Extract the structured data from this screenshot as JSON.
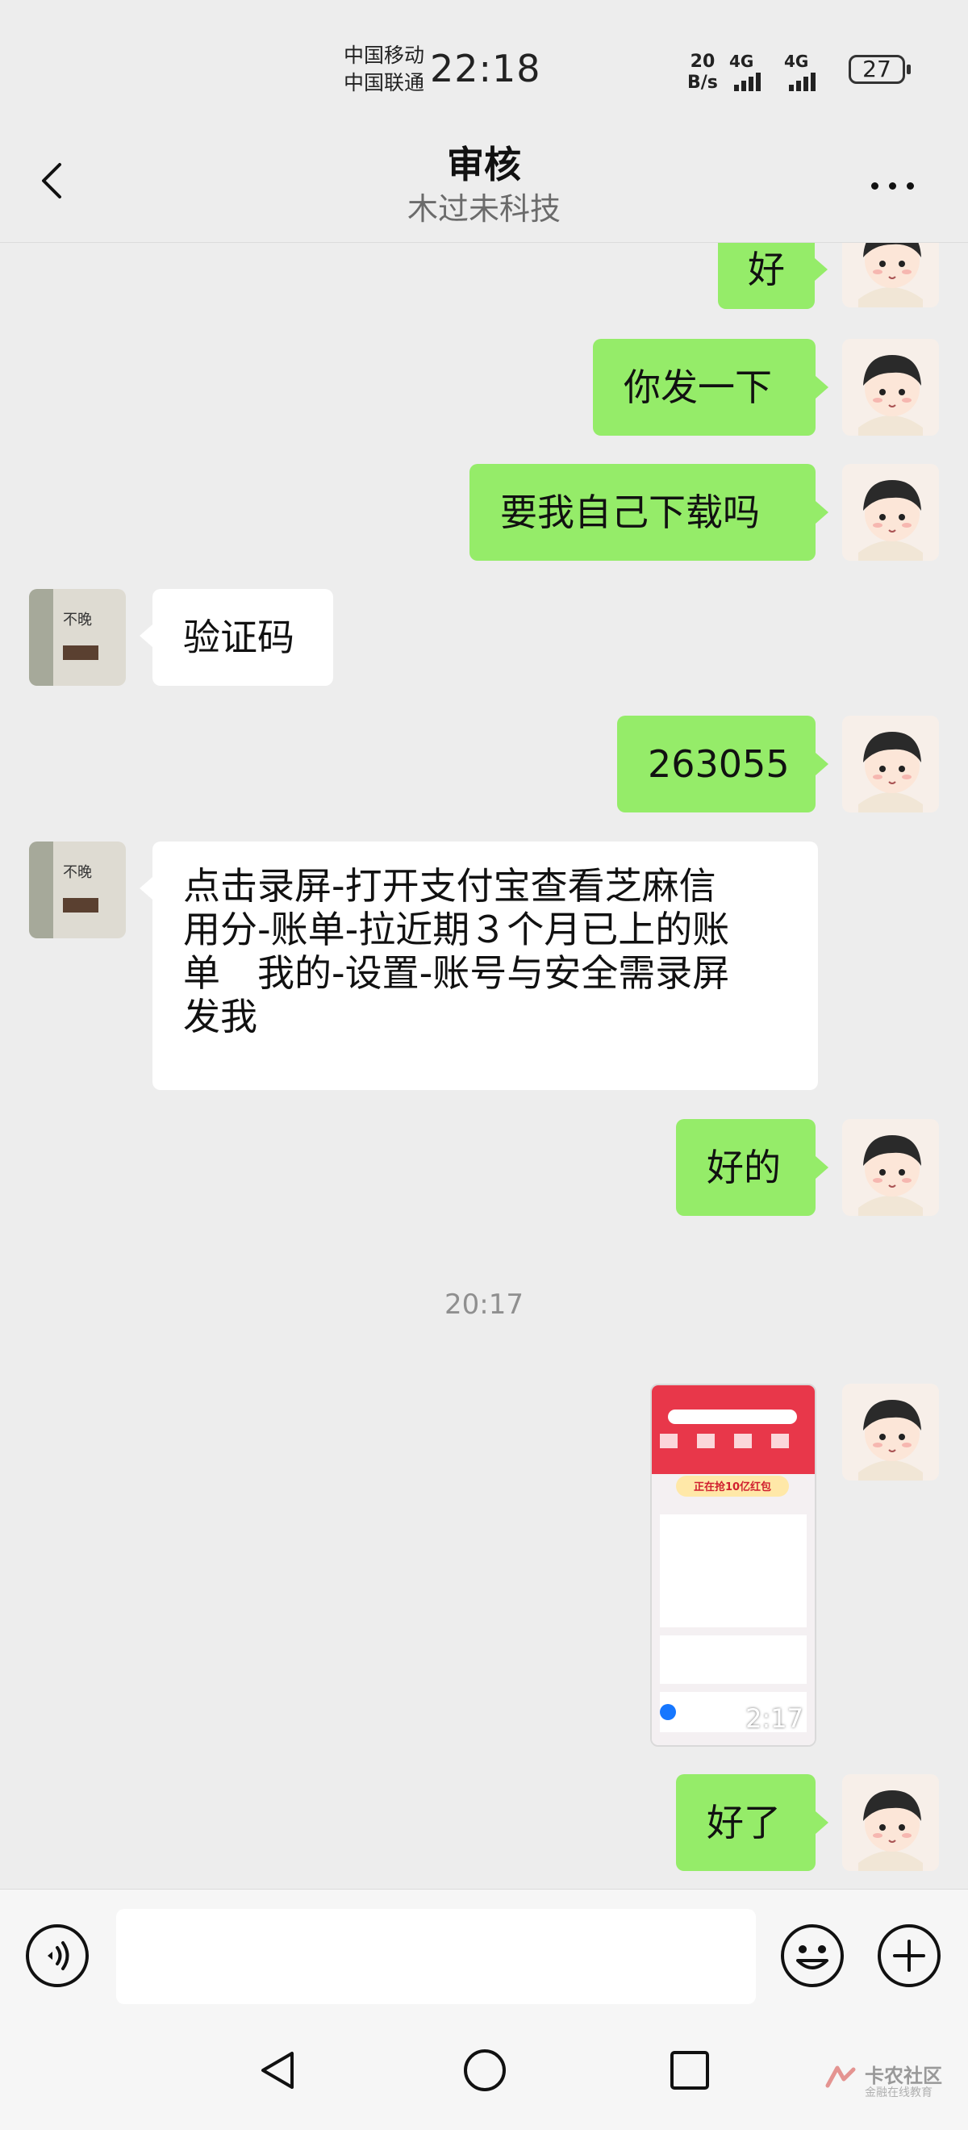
{
  "status_bar": {
    "carrier_1": "中国移动",
    "carrier_2": "中国联通",
    "time": "22:18",
    "net_speed_value": "20",
    "net_speed_unit": "B/s",
    "signal_1_label": "4G",
    "signal_2_label": "4G",
    "battery": "27"
  },
  "header": {
    "title": "审核",
    "subtitle": "木过未科技"
  },
  "messages": [
    {
      "side": "me",
      "text": "好"
    },
    {
      "side": "me",
      "text": "你发一下"
    },
    {
      "side": "me",
      "text": "要我自己下载吗"
    },
    {
      "side": "other",
      "text": "验证码"
    },
    {
      "side": "me",
      "text": "263055"
    },
    {
      "side": "other",
      "lines": [
        "点击录屏-打开支付宝查看芝麻信",
        "用分-账单-拉近期３个月已上的账",
        "单　我的-设置-账号与安全需录屏",
        "发我"
      ]
    },
    {
      "side": "me",
      "text": "好的"
    },
    {
      "side": "me",
      "type": "video",
      "duration": "2:17"
    },
    {
      "side": "me",
      "text": "好了"
    }
  ],
  "timestamp": "20:17",
  "contact_avatar_text": "不晚",
  "video_thumb": {
    "banner": "正在抢10亿红包"
  },
  "input": {
    "placeholder": "",
    "value": ""
  },
  "watermark": {
    "text": "卡农社区",
    "sub": "金融在线教育"
  },
  "colors": {
    "my_bubble": "#95ec69",
    "other_bubble": "#ffffff",
    "background": "#ededed"
  },
  "icons": [
    "back-arrow-icon",
    "more-dots-icon",
    "voice-icon",
    "emoji-icon",
    "plus-icon",
    "nav-back-icon",
    "nav-home-icon",
    "nav-recent-icon",
    "play-icon"
  ]
}
